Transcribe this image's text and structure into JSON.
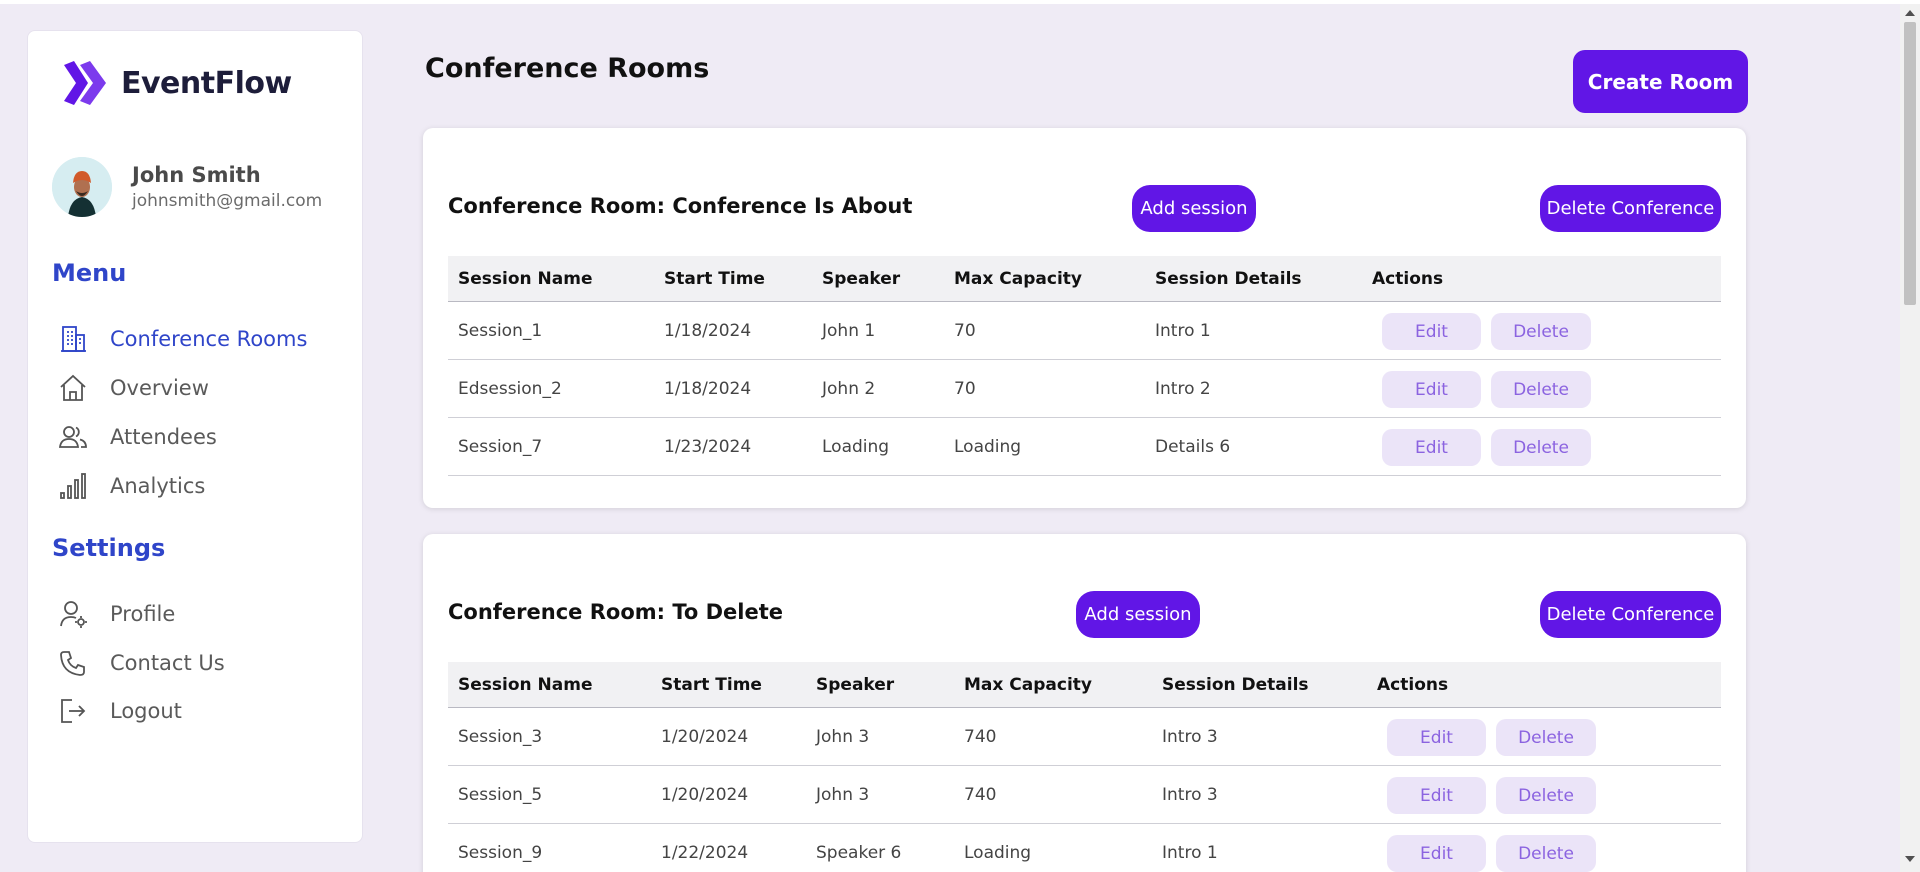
{
  "app": {
    "name": "EventFlow"
  },
  "user": {
    "name": "John Smith",
    "email": "johnsmith@gmail.com"
  },
  "sidebar": {
    "menu_title": "Menu",
    "menu_items": [
      {
        "label": "Conference Rooms",
        "icon": "building-icon",
        "active": true
      },
      {
        "label": "Overview",
        "icon": "home-icon"
      },
      {
        "label": "Attendees",
        "icon": "users-icon"
      },
      {
        "label": "Analytics",
        "icon": "bar-chart-icon"
      }
    ],
    "settings_title": "Settings",
    "settings_items": [
      {
        "label": "Profile",
        "icon": "user-settings-icon"
      },
      {
        "label": "Contact Us",
        "icon": "phone-icon"
      },
      {
        "label": "Logout",
        "icon": "logout-icon"
      }
    ]
  },
  "main": {
    "title": "Conference Rooms",
    "create_label": "Create Room",
    "columns": [
      "Session Name",
      "Start Time",
      "Speaker",
      "Max Capacity",
      "Session Details",
      "Actions"
    ],
    "edit_label": "Edit",
    "delete_label": "Delete",
    "add_session_label": "Add session",
    "delete_conference_label": "Delete Conference",
    "rooms": [
      {
        "title": "Conference Room: Conference Is About",
        "sessions": [
          [
            "Session_1",
            "1/18/2024",
            "John 1",
            "70",
            "Intro 1"
          ],
          [
            "Edsession_2",
            "1/18/2024",
            "John 2",
            "70",
            "Intro 2"
          ],
          [
            "Session_7",
            "1/23/2024",
            "Loading",
            "Loading",
            "Details 6"
          ]
        ]
      },
      {
        "title": "Conference Room: To Delete",
        "sessions": [
          [
            "Session_3",
            "1/20/2024",
            "John 3",
            "740",
            "Intro 3"
          ],
          [
            "Session_5",
            "1/20/2024",
            "John 3",
            "740",
            "Intro 3"
          ],
          [
            "Session_9",
            "1/22/2024",
            "Speaker 6",
            "Loading",
            "Intro 1"
          ]
        ]
      }
    ]
  },
  "colors": {
    "accent": "#6116e6",
    "nav_active": "#2f45c9",
    "action_bg": "#ebe4f8",
    "action_text": "#8b63e0"
  }
}
